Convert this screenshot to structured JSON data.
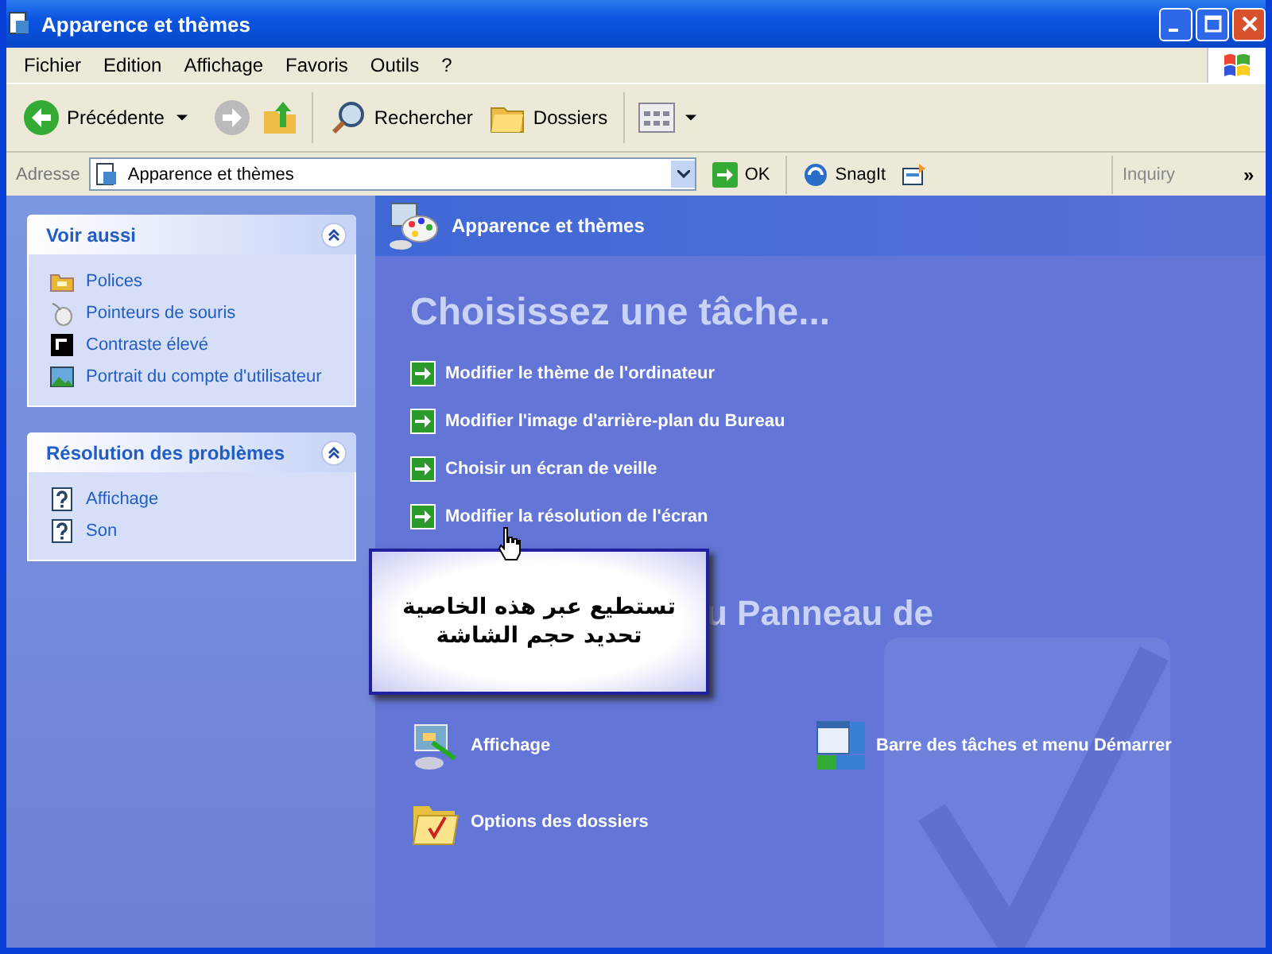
{
  "window": {
    "title": "Apparence et thèmes"
  },
  "menu": [
    "Fichier",
    "Edition",
    "Affichage",
    "Favoris",
    "Outils",
    "?"
  ],
  "toolbar": {
    "back": "Précédente",
    "search": "Rechercher",
    "folders": "Dossiers"
  },
  "address_bar": {
    "label": "Adresse",
    "value": "Apparence et thèmes",
    "go": "OK",
    "snagit": "SnagIt",
    "inquiry": "Inquiry",
    "overflow": "»"
  },
  "sidebar": [
    {
      "title": "Voir aussi",
      "expanded": true,
      "items": [
        {
          "label": "Polices",
          "kind": "folder"
        },
        {
          "label": "Pointeurs de souris",
          "kind": "mouse"
        },
        {
          "label": "Contraste élevé",
          "kind": "contrast"
        },
        {
          "label": "Portrait du compte d'utilisateur",
          "kind": "picture"
        }
      ]
    },
    {
      "title": "Résolution des problèmes",
      "expanded": true,
      "items": [
        {
          "label": "Affichage",
          "kind": "help"
        },
        {
          "label": "Son",
          "kind": "help"
        }
      ]
    }
  ],
  "header": "Apparence et thèmes",
  "heading": "Choisissez une tâche...",
  "tasks": [
    "Modifier le thème de l'ordinateur",
    "Modifier l'image d'arrière-plan du Bureau",
    "Choisir un écran de veille",
    "Modifier la résolution de l'écran"
  ],
  "section_heading": "u Panneau de",
  "icons": [
    {
      "label": "Affichage",
      "kind": "display"
    },
    {
      "label": "Barre des tâches et menu Démarrer",
      "kind": "taskbar"
    },
    {
      "label": "Options des dossiers",
      "kind": "folder"
    }
  ],
  "callout": {
    "lines": [
      "تستطيع عبر هذه الخاصية",
      "تحديد حجم الشاشة"
    ]
  }
}
